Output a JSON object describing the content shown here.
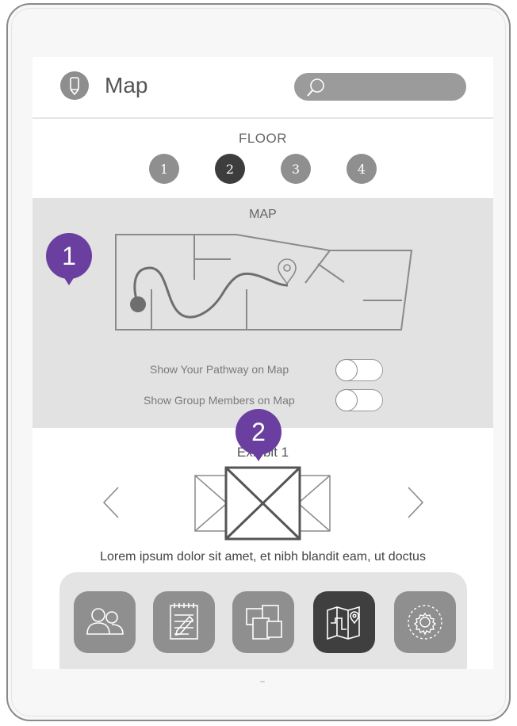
{
  "header": {
    "title": "Map",
    "app_icon": "phone-icon",
    "search_icon": "search-icon"
  },
  "floor": {
    "label": "FLOOR",
    "buttons": [
      "1",
      "2",
      "3",
      "4"
    ],
    "active_index": 1
  },
  "map": {
    "title": "MAP",
    "toggles": [
      {
        "label": "Show Your Pathway on Map",
        "on": false
      },
      {
        "label": "Show Group Members on Map",
        "on": false
      }
    ]
  },
  "markers": [
    "1",
    "2"
  ],
  "exhibit": {
    "title": "Exhibit 1",
    "description": "Lorem ipsum dolor sit amet, et nibh blandit eam, ut doctus"
  },
  "dock": {
    "items": [
      {
        "icon": "group-icon",
        "active": false
      },
      {
        "icon": "notepad-icon",
        "active": false
      },
      {
        "icon": "gallery-icon",
        "active": false
      },
      {
        "icon": "map-icon",
        "active": true
      },
      {
        "icon": "settings-icon",
        "active": false
      }
    ]
  },
  "colors": {
    "accent": "#6a3fa0",
    "active": "#3d3d3d",
    "inactive": "#8f8f8f",
    "panel": "#e2e2e2"
  }
}
